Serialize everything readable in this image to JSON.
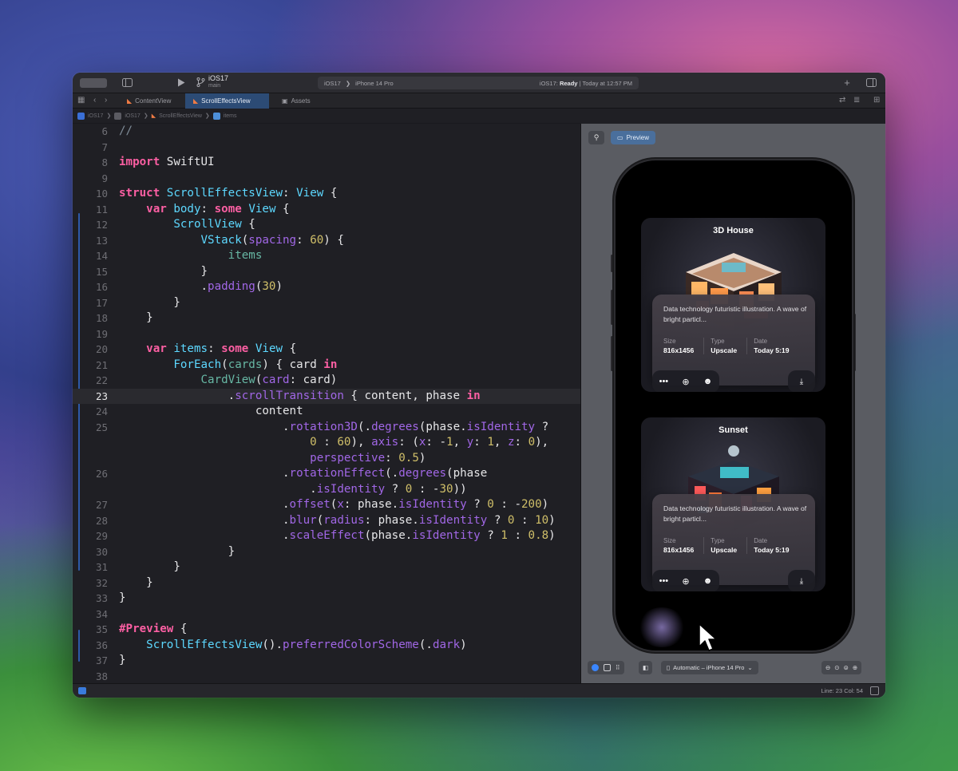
{
  "window": {
    "scheme_name": "iOS17",
    "branch": "main",
    "destination_project": "iOS17",
    "destination_device": "iPhone 14 Pro",
    "status_project": "iOS17:",
    "status_state": "Ready",
    "status_time": "| Today at 12:57 PM"
  },
  "tabs": [
    {
      "label": "ContentView",
      "active": false
    },
    {
      "label": "ScrollEffectsView",
      "active": true
    },
    {
      "label": "Assets",
      "active": false
    }
  ],
  "breadcrumb": [
    "iOS17",
    "iOS17",
    "ScrollEffectsView",
    "items"
  ],
  "editor": {
    "current_line": "23",
    "line_numbers": [
      "6",
      "7",
      "8",
      "9",
      "10",
      "11",
      "12",
      "13",
      "14",
      "15",
      "16",
      "17",
      "18",
      "19",
      "20",
      "21",
      "22",
      "23",
      "24",
      "25",
      "",
      "",
      "26",
      "",
      "27",
      "28",
      "29",
      "30",
      "31",
      "32",
      "33",
      "34",
      "35",
      "36",
      "37",
      "38"
    ]
  },
  "preview": {
    "preview_label": "Preview",
    "device_selector": "Automatic – iPhone 14 Pro",
    "cards": [
      {
        "title": "3D House",
        "description": "Data technology futuristic illustration. A wave of bright particl...",
        "size_label": "Size",
        "size_value": "816x1456",
        "type_label": "Type",
        "type_value": "Upscale",
        "date_label": "Date",
        "date_value": "Today 5:19"
      },
      {
        "title": "Sunset",
        "description": "Data technology futuristic illustration. A wave of bright particl...",
        "size_label": "Size",
        "size_value": "816x1456",
        "type_label": "Type",
        "type_value": "Upscale",
        "date_label": "Date",
        "date_value": "Today 5:19"
      }
    ]
  },
  "statusbar": {
    "position": "Line: 23  Col: 54"
  },
  "icons": {
    "sidebar": "sidebar-icon",
    "run": "play-icon",
    "branch": "branch-icon",
    "add": "plus-icon",
    "inspector": "inspector-icon",
    "pin": "pin-icon",
    "more": "ellipsis-icon",
    "zoom": "zoom-icon",
    "emoji": "smiley-icon",
    "download": "download-icon"
  },
  "colors": {
    "keyword": "#fc5fa3",
    "type": "#5dd8ff",
    "function": "#67b7a4",
    "argument_label": "#a167e6",
    "number": "#d0bf69",
    "comment": "#7f8c98",
    "tab_active": "#2c4b75",
    "accent_blue": "#3a86ff"
  }
}
